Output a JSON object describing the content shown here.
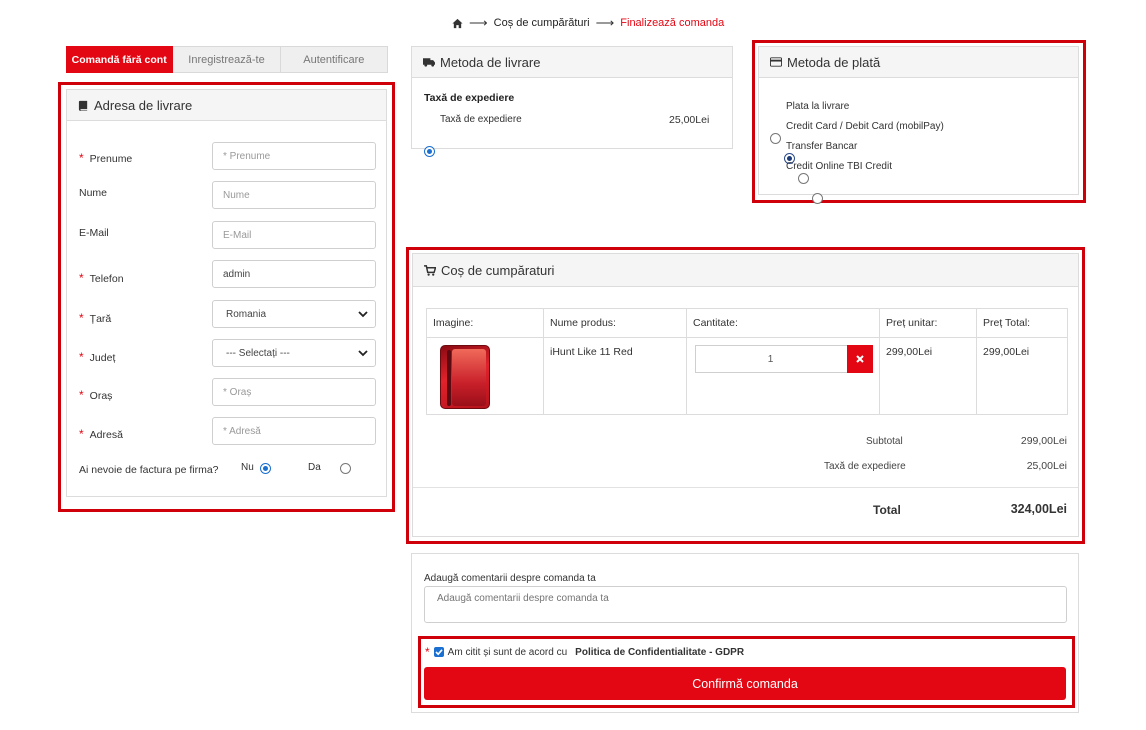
{
  "breadcrumb": {
    "home_icon": "home-icon",
    "cart": "Coș de cumpărături",
    "current": "Finalizează comanda"
  },
  "tabs": [
    {
      "label": "Comandă fără cont",
      "active": true
    },
    {
      "label": "Inregistrează-te",
      "active": false
    },
    {
      "label": "Autentificare",
      "active": false
    }
  ],
  "address": {
    "title": "Adresa de livrare",
    "fields": {
      "first_name": {
        "label": "Prenume",
        "placeholder": "* Prenume",
        "value": ""
      },
      "last_name": {
        "label": "Nume",
        "placeholder": "Nume",
        "value": ""
      },
      "email": {
        "label": "E-Mail",
        "placeholder": "E-Mail",
        "value": ""
      },
      "phone": {
        "label": "Telefon",
        "placeholder": "",
        "value": "admin"
      },
      "country": {
        "label": "Țară",
        "value": "Romania"
      },
      "county": {
        "label": "Județ",
        "value": "--- Selectați ---"
      },
      "city": {
        "label": "Oraș",
        "placeholder": "* Oraș",
        "value": ""
      },
      "street": {
        "label": "Adresă",
        "placeholder": "* Adresă",
        "value": ""
      }
    },
    "invoice": {
      "question": "Ai nevoie de factura pe firma?",
      "no": "Nu",
      "yes": "Da",
      "selected": "Nu"
    }
  },
  "shipping": {
    "title": "Metoda de livrare",
    "subtitle": "Taxă de expediere",
    "option_label": "Taxă de expediere",
    "option_price": "25,00Lei"
  },
  "payment": {
    "title": "Metoda de plată",
    "options": [
      {
        "label": "Plata la livrare",
        "selected": false
      },
      {
        "label": "Credit Card / Debit Card (mobilPay)",
        "selected": true
      },
      {
        "label": "Transfer Bancar",
        "selected": false
      },
      {
        "label": "Credit Online TBI Credit",
        "selected": false
      }
    ]
  },
  "cart": {
    "title": "Coș de cumpăraturi",
    "headers": [
      "Imagine:",
      "Nume produs:",
      "Cantitate:",
      "Preț unitar:",
      "Preț Total:"
    ],
    "items": [
      {
        "name": "iHunt Like 11 Red",
        "quantity": "1",
        "unit_price": "299,00Lei",
        "total_price": "299,00Lei"
      }
    ],
    "subtotal_label": "Subtotal",
    "subtotal_value": "299,00Lei",
    "shipping_label": "Taxă de expediere",
    "shipping_value": "25,00Lei",
    "total_label": "Total",
    "total_value": "324,00Lei"
  },
  "comments": {
    "label": "Adaugă comentarii despre comanda ta",
    "placeholder": "Adaugă comentarii despre comanda ta"
  },
  "agreement": {
    "text": "Am citit și sunt de acord cu",
    "link": "Politica de Confidentialitate - GDPR",
    "checked": true
  },
  "confirm_label": "Confirmă comanda",
  "colors": {
    "accent": "#e30613",
    "highlight_frame": "#d0000a",
    "radio_selected": "#1a6fd1"
  }
}
